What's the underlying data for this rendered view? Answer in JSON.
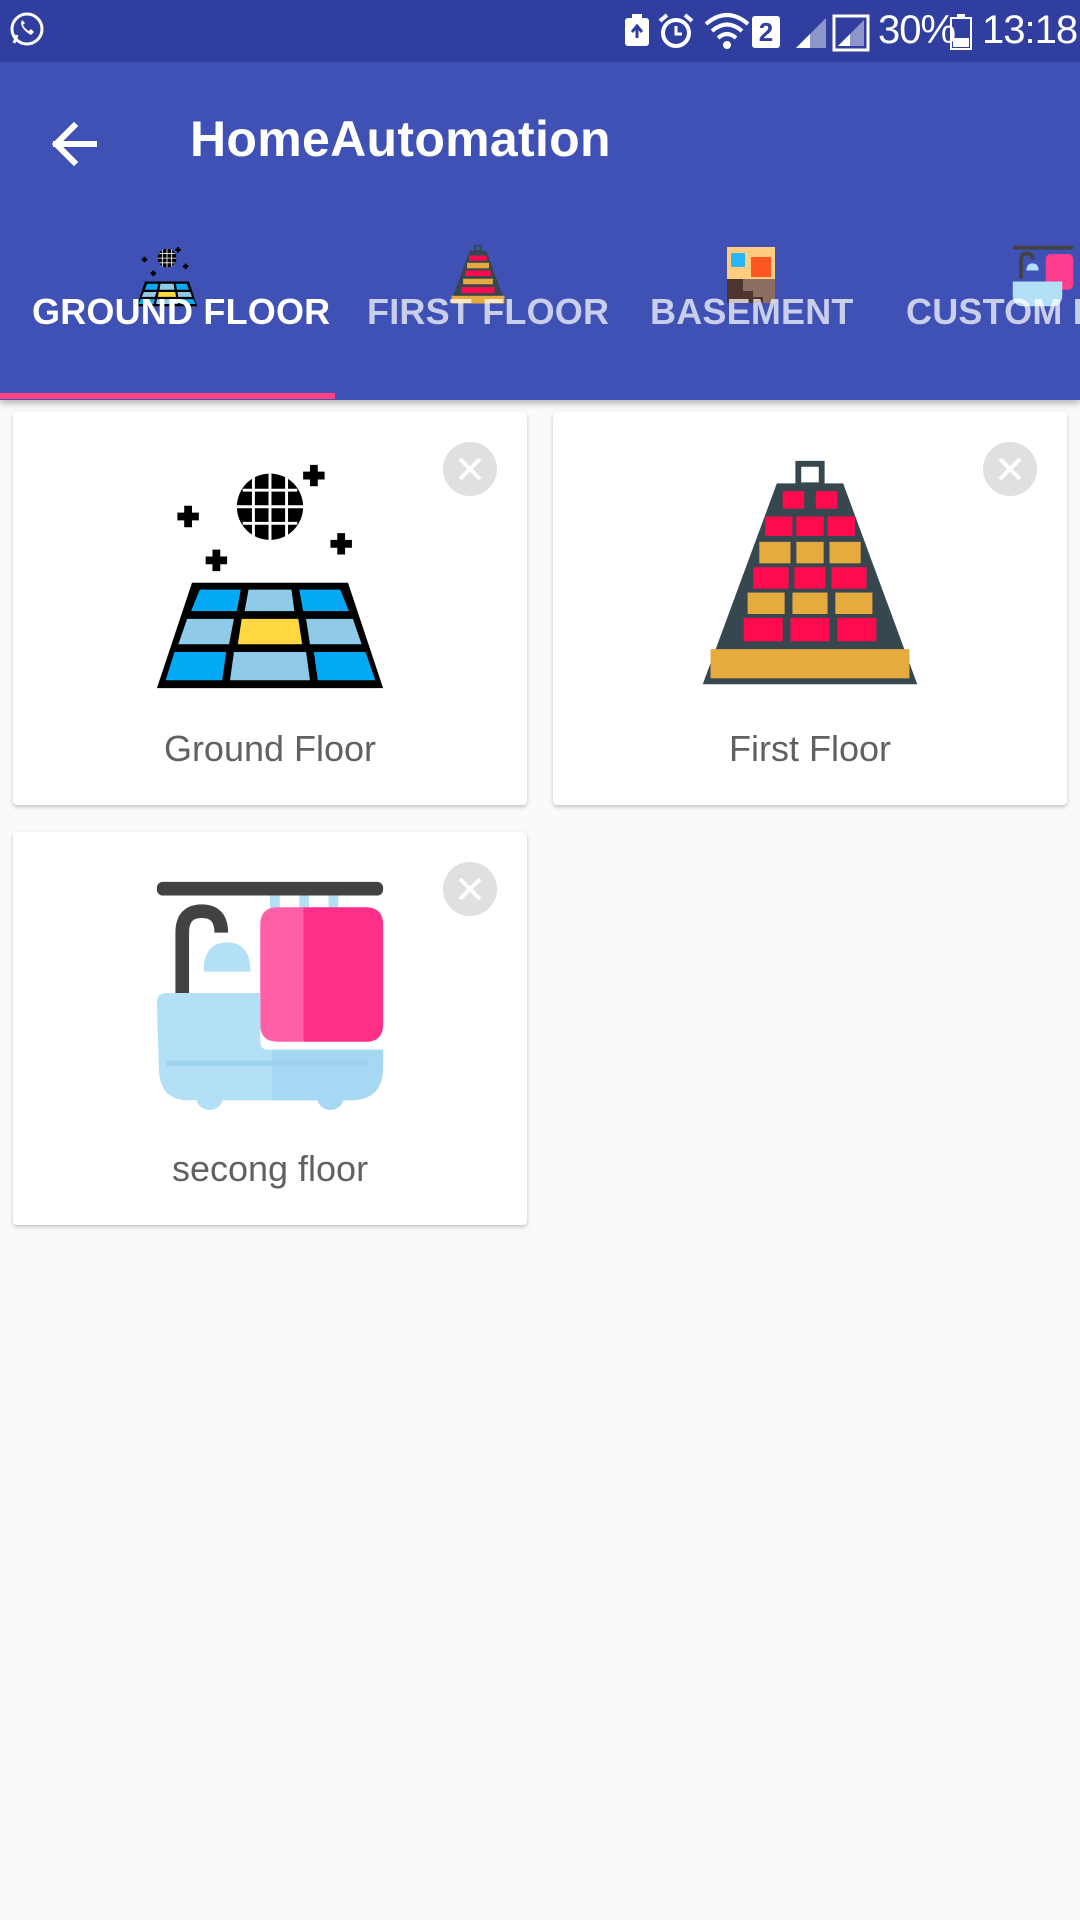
{
  "status_bar": {
    "battery_percent": "30%",
    "time": "13:18",
    "sim_badge": "2",
    "icons": [
      "whatsapp-icon",
      "battery-saver-icon",
      "alarm-icon",
      "wifi-icon",
      "signal-icon",
      "battery-icon"
    ]
  },
  "app_bar": {
    "title": "HomeAutomation",
    "back_icon": "arrow-back-icon"
  },
  "tabs": [
    {
      "label": "GROUND FLOOR",
      "icon": "dance-floor-icon",
      "active": true
    },
    {
      "label": "FIRST FLOOR",
      "icon": "tower-icon",
      "active": false
    },
    {
      "label": "BASEMENT",
      "icon": "stairs-icon",
      "active": false
    },
    {
      "label": "CUSTOM F",
      "icon": "bathtub-icon",
      "active": false
    }
  ],
  "floors": [
    {
      "name": "Ground Floor",
      "icon": "dance-floor-icon"
    },
    {
      "name": "First Floor",
      "icon": "tower-icon"
    },
    {
      "name": "secong floor",
      "icon": "bathtub-icon"
    }
  ],
  "colors": {
    "primary": "#3f51b5",
    "primary_dark": "#303f9f",
    "accent": "#ff4081",
    "background": "#fafafa"
  }
}
